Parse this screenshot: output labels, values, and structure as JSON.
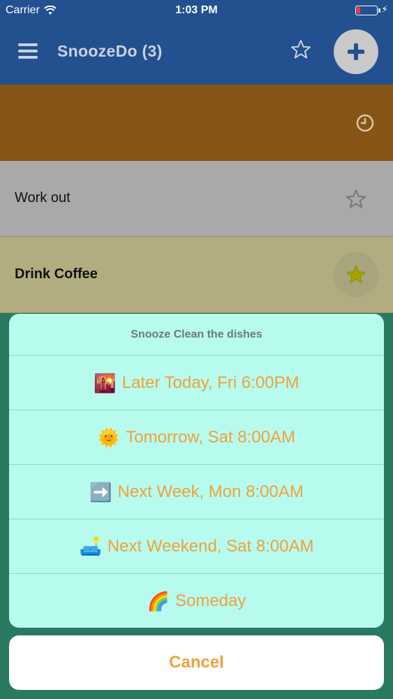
{
  "status_bar": {
    "carrier": "Carrier",
    "time": "1:03 PM",
    "battery_level": 0.1,
    "battery_color": "#ff3b30"
  },
  "nav": {
    "title": "SnoozeDo (3)",
    "menu_icon": "hamburger-icon",
    "star_icon": "star-outline-icon",
    "add_icon": "plus-icon"
  },
  "tasks": [
    {
      "label": "",
      "icon": "clock-icon",
      "color": "#875515"
    },
    {
      "label": "Work out",
      "icon": "star-outline-icon",
      "color": "#a9a9a9"
    },
    {
      "label": "Drink Coffee",
      "icon": "star-filled-icon",
      "color": "#b2ad80"
    }
  ],
  "sheet": {
    "title": "Snooze Clean the dishes",
    "options": [
      {
        "emoji": "🌇",
        "label": "Later Today, Fri 6:00PM"
      },
      {
        "emoji": "🌞",
        "label": "Tomorrow, Sat 8:00AM"
      },
      {
        "emoji": "➡️",
        "label": "Next Week, Mon 8:00AM"
      },
      {
        "emoji": "🛋️",
        "label": "Next Weekend, Sat 8:00AM"
      },
      {
        "emoji": "🌈",
        "label": "Someday"
      }
    ],
    "cancel_label": "Cancel"
  },
  "colors": {
    "nav": "#23508f",
    "accent": "#f0a13b",
    "sheet": "#b7fbef",
    "backdrop": "#2a7a62"
  }
}
